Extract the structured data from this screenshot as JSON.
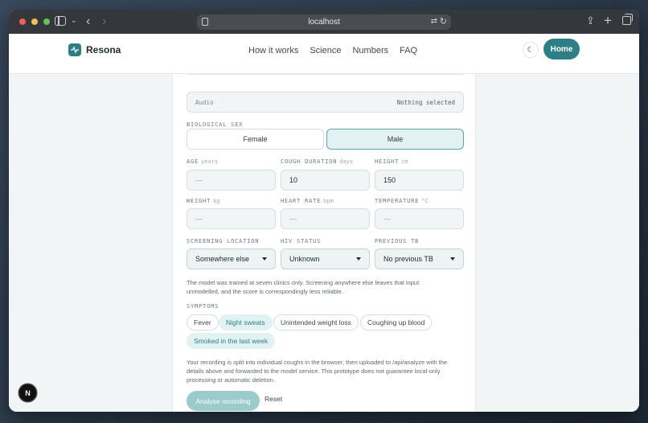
{
  "browser": {
    "url": "localhost"
  },
  "header": {
    "brand": "Resona",
    "nav": [
      "How it works",
      "Science",
      "Numbers",
      "FAQ"
    ],
    "home_label": "Home",
    "theme_icon": "moon-icon"
  },
  "form": {
    "audio": {
      "label": "Audio",
      "value": "Nothing selected"
    },
    "sex": {
      "label": "BIOLOGICAL SEX",
      "options": [
        "Female",
        "Male"
      ],
      "selected": "Male"
    },
    "age": {
      "label": "AGE",
      "unit": "years",
      "value": "—"
    },
    "cough_duration": {
      "label": "COUGH DURATION",
      "unit": "days",
      "value": "10"
    },
    "height": {
      "label": "HEIGHT",
      "unit": "cm",
      "value": "150"
    },
    "weight": {
      "label": "WEIGHT",
      "unit": "kg",
      "value": "—"
    },
    "heart_rate": {
      "label": "HEART RATE",
      "unit": "bpm",
      "value": "—"
    },
    "temperature": {
      "label": "TEMPERATURE",
      "unit": "°C",
      "value": "—"
    },
    "screening_location": {
      "label": "SCREENING LOCATION",
      "value": "Somewhere else"
    },
    "hiv_status": {
      "label": "HIV STATUS",
      "value": "Unknown"
    },
    "previous_tb": {
      "label": "PREVIOUS TB",
      "value": "No previous TB"
    },
    "location_note": "The model was trained at seven clinics only. Screening anywhere else leaves that input unmodelled, and the score is correspondingly less reliable.",
    "symptoms": {
      "label": "SYMPTOMS",
      "items": [
        {
          "label": "Fever",
          "selected": false
        },
        {
          "label": "Night sweats",
          "selected": true
        },
        {
          "label": "Unintended weight loss",
          "selected": false
        },
        {
          "label": "Coughing up blood",
          "selected": false
        },
        {
          "label": "Smoked in the last week",
          "selected": true
        }
      ]
    },
    "privacy_note": "Your recording is split into individual coughs in the browser, then uploaded to /api/analyze with the details above and forwarded to the model service. This prototype does not guarantee local-only processing or automatic deletion.",
    "analyse_label": "Analyse recording",
    "reset_label": "Reset"
  },
  "dev_badge": "N",
  "colors": {
    "accent": "#2d7f86",
    "accent_light": "#e2f1f1",
    "page_bg": "#f1f5f5"
  }
}
